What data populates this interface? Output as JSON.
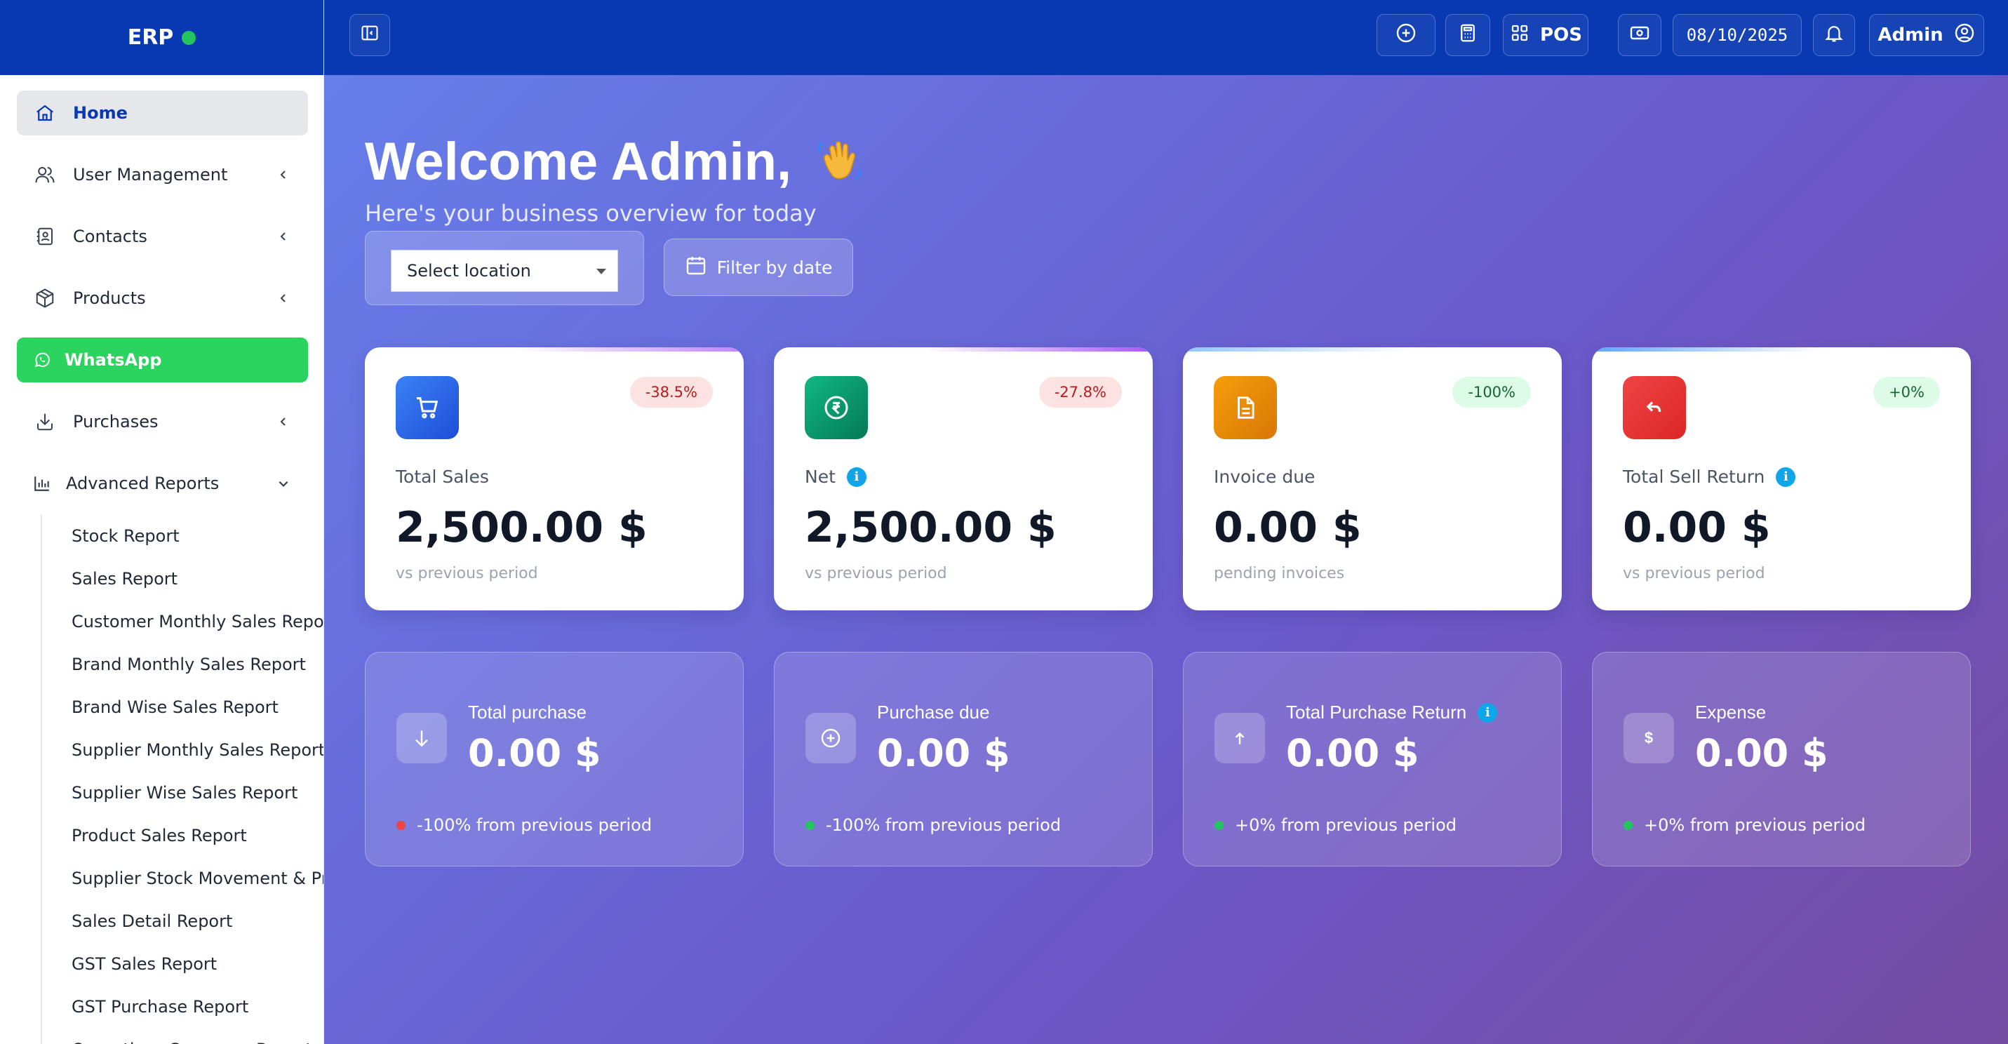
{
  "brand": {
    "name": "ERP",
    "status_color": "#22c55e"
  },
  "colors": {
    "topbar": "#0839b3",
    "whatsapp": "#2bd35f",
    "badge_negative": "#fde2e2",
    "badge_positive": "#dcfce7"
  },
  "sidebar": {
    "items": [
      {
        "label": "Home",
        "icon": "home-icon",
        "active": true
      },
      {
        "label": "User Management",
        "icon": "users-icon",
        "expandable": true
      },
      {
        "label": "Contacts",
        "icon": "address-book-icon",
        "expandable": true
      },
      {
        "label": "Products",
        "icon": "box-icon",
        "expandable": true
      },
      {
        "label": "WhatsApp",
        "icon": "whatsapp-icon"
      },
      {
        "label": "Purchases",
        "icon": "download-icon",
        "expandable": true
      },
      {
        "label": "Advanced Reports",
        "icon": "bar-chart-icon",
        "expanded": true
      }
    ],
    "reports": [
      "Stock Report",
      "Sales Report",
      "Customer Monthly Sales Repor",
      "Brand Monthly Sales Report",
      "Brand Wise Sales Report",
      "Supplier Monthly Sales Report",
      "Supplier Wise Sales Report",
      "Product Sales Report",
      "Supplier Stock Movement & Pro",
      "Sales Detail Report",
      "GST Sales Report",
      "GST Purchase Report",
      "Operations Summary Report"
    ]
  },
  "topbar": {
    "pos_label": "POS",
    "date": "08/10/2025",
    "user_label": "Admin"
  },
  "welcome": {
    "title": "Welcome Admin,",
    "subtitle": "Here's your business overview for today"
  },
  "filters": {
    "location_value": "Select location",
    "date_button": "Filter by date"
  },
  "stat_cards": [
    {
      "label": "Total Sales",
      "value": "2,500.00 $",
      "note": "vs previous period",
      "badge": "-38.5%",
      "icon": "cart-icon",
      "color": "#2563eb"
    },
    {
      "label": "Net",
      "value": "2,500.00 $",
      "note": "vs previous period",
      "badge": "-27.8%",
      "icon": "rupee-icon",
      "color": "#059669"
    },
    {
      "label": "Invoice due",
      "value": "0.00 $",
      "note": "pending invoices",
      "badge": "-100%",
      "icon": "document-icon",
      "color": "#f59e0b"
    },
    {
      "label": "Total Sell Return",
      "value": "0.00 $",
      "note": "vs previous period",
      "badge": "+0%",
      "icon": "return-icon",
      "color": "#ef4444"
    }
  ],
  "summary_cards": [
    {
      "label": "Total purchase",
      "value": "0.00 $",
      "note": "-100% from previous period",
      "icon": "arrow-down-icon",
      "dot_color": "#ef4444"
    },
    {
      "label": "Purchase due",
      "value": "0.00 $",
      "note": "-100% from previous period",
      "icon": "plus-circle-icon",
      "dot_color": "#22c55e"
    },
    {
      "label": "Total Purchase Return",
      "value": "0.00 $",
      "note": "+0% from previous period",
      "icon": "arrow-up-icon",
      "dot_color": "#22c55e"
    },
    {
      "label": "Expense",
      "value": "0.00 $",
      "note": "+0% from previous period",
      "icon": "dollar-icon",
      "dot_color": "#22c55e"
    }
  ]
}
